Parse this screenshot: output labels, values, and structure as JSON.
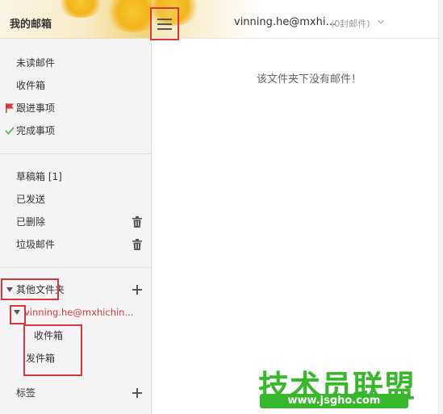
{
  "sidebar": {
    "title": "我的邮箱",
    "group1": [
      "未读邮件",
      "收件箱",
      "跟进事项",
      "完成事项"
    ],
    "group2": {
      "drafts": "草稿箱 [1]",
      "sent": "已发送",
      "deleted": "已删除",
      "spam": "垃圾邮件"
    },
    "other_folders": "其他文件夹",
    "account": "vinning.he@mxhichin...",
    "sub_inbox": "收件箱",
    "sub_sent": "发件箱",
    "tags": "标签"
  },
  "header": {
    "account": "vinning.he@mxhi...",
    "count": "(0封邮件)"
  },
  "main": {
    "empty_message": "该文件夹下没有邮件！"
  },
  "watermark": {
    "main": "技术员联盟",
    "url": "www.jsgho.com"
  },
  "colors": {
    "highlight": "#d9373b",
    "flag": "#d9373b",
    "check": "#5cb85c",
    "account_text": "#d9373b",
    "watermark": "#36b82a"
  }
}
